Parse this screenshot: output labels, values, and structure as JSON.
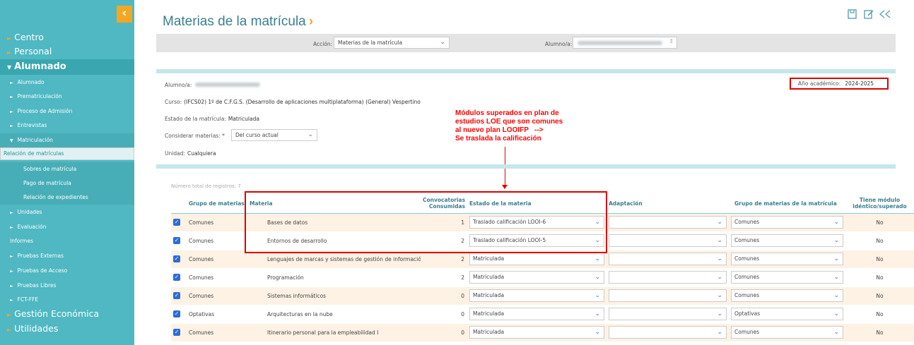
{
  "sidebar": {
    "sections": [
      "Centro",
      "Personal",
      "Alumnado",
      "Gestión Económica",
      "Utilidades"
    ],
    "items": [
      "Alumnado",
      "Prematriculación",
      "Proceso de Admisión",
      "Entrevistas",
      "Matriculación",
      "Unidades",
      "Evaluación",
      "Informes",
      "Pruebas Externas",
      "Pruebas de Acceso",
      "Pruebas Libres",
      "FCT-FFE"
    ],
    "subitems": [
      "Relación de matrículas",
      "Sobres de matrícula",
      "Pago de matrícula",
      "Relación de expedientes"
    ]
  },
  "page": {
    "title": "Materias de la matrícula"
  },
  "toolbar": {
    "icons": [
      "save-icon",
      "edit-icon",
      "back-icon"
    ]
  },
  "action_bar": {
    "accion_label": "Acción:",
    "accion_value": "Materias de la matrícula",
    "alumno_label": "Alumno/a:"
  },
  "info": {
    "alumno_label": "Alumno/a:",
    "curso_label": "Curso:",
    "curso_value": "(IFCS02) 1º de C.F.G.S. (Desarrollo de aplicaciones multiplataforma) (General) Vespertino",
    "estado_label": "Estado de la matrícula:",
    "estado_value": "Matriculada",
    "considerar_label": "Considerar materias: *",
    "considerar_value": "Del curso actual",
    "unidad_label": "Unidad:",
    "unidad_value": "Cualquiera",
    "anio_label": "Año académico:",
    "anio_value": "2024-2025"
  },
  "annotation": "Módulos superados en plan de\nestudios LOE que son comunes\nal nuevo plan LOOIFP   -->\nSe traslada la calificación",
  "table": {
    "total": "Número total de registros: 7",
    "headers": {
      "grupo": "Grupo de materias",
      "materia": "Materia",
      "conv": "Convocatorias Consumidas",
      "estado": "Estado de la materia",
      "adapt": "Adaptación",
      "grupo_mat": "Grupo de materias de la matrícula",
      "tiene": "Tiene módulo idéntico/superado"
    },
    "rows": [
      {
        "grupo": "Comunes",
        "materia": "Bases de datos",
        "conv": "1",
        "estado": "Traslado calificación LOOI-6",
        "adapt": "",
        "grupo_mat": "Comunes",
        "tiene": "No"
      },
      {
        "grupo": "Comunes",
        "materia": "Entornos de desarrollo",
        "conv": "2",
        "estado": "Traslado calificación LOOI-5",
        "adapt": "",
        "grupo_mat": "Comunes",
        "tiene": "No"
      },
      {
        "grupo": "Comunes",
        "materia": "Lenguajes de marcas y sistemas de gestión de información",
        "conv": "2",
        "estado": "Matriculada",
        "adapt": "",
        "grupo_mat": "Comunes",
        "tiene": "No"
      },
      {
        "grupo": "Comunes",
        "materia": "Programación",
        "conv": "2",
        "estado": "Matriculada",
        "adapt": "",
        "grupo_mat": "Comunes",
        "tiene": "No"
      },
      {
        "grupo": "Comunes",
        "materia": "Sistemas informáticos",
        "conv": "0",
        "estado": "Matriculada",
        "adapt": "",
        "grupo_mat": "Comunes",
        "tiene": "No"
      },
      {
        "grupo": "Optativas",
        "materia": "Arquitecturas en la nube",
        "conv": "0",
        "estado": "Matriculada",
        "adapt": "",
        "grupo_mat": "Optativas",
        "tiene": "No"
      },
      {
        "grupo": "Comunes",
        "materia": "Itinerario personal para la empleabilidad I",
        "conv": "0",
        "estado": "Matriculada",
        "adapt": "",
        "grupo_mat": "Comunes",
        "tiene": "No"
      }
    ]
  },
  "colors": {
    "sidebar": "#4fb8c2",
    "accent": "#f5a623",
    "annotation": "#ff0000"
  }
}
